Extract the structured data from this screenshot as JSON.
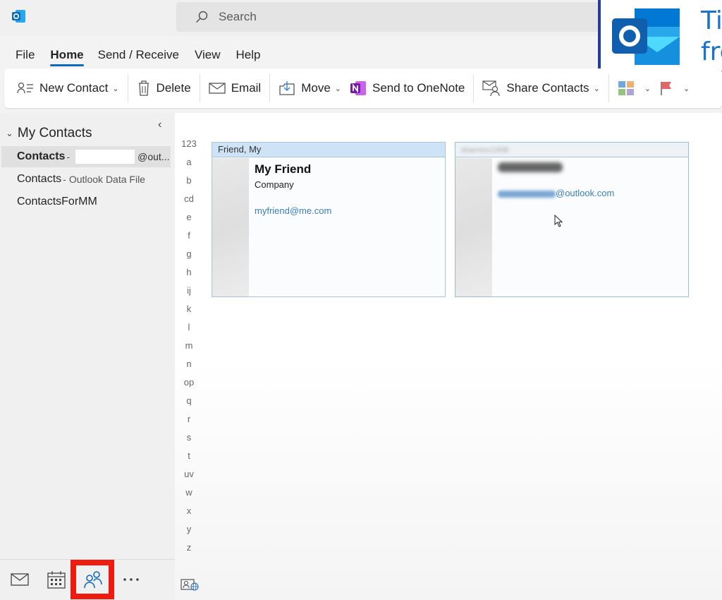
{
  "titlebar": {
    "app_icon": "outlook-logo-icon",
    "search_placeholder": "Search",
    "overlay_text_line1": "Ti",
    "overlay_text_line2": "fre"
  },
  "menu": {
    "tabs": [
      {
        "label": "File",
        "active": false
      },
      {
        "label": "Home",
        "active": true
      },
      {
        "label": "Send / Receive",
        "active": false
      },
      {
        "label": "View",
        "active": false
      },
      {
        "label": "Help",
        "active": false
      }
    ]
  },
  "ribbon": {
    "new_contact": "New Contact",
    "delete": "Delete",
    "email": "Email",
    "move": "Move",
    "send_to_onenote": "Send to OneNote",
    "share_contacts": "Share Contacts"
  },
  "folders": {
    "header": "My Contacts",
    "items": [
      {
        "label": "Contacts",
        "separator": " -",
        "suffix": "@out..."
      },
      {
        "label": "Contacts",
        "separator": " -",
        "sub": "Outlook Data File"
      },
      {
        "label": "ContactsForMM"
      }
    ]
  },
  "alphabet": [
    "123",
    "a",
    "b",
    "cd",
    "e",
    "f",
    "g",
    "h",
    "ij",
    "k",
    "l",
    "m",
    "n",
    "op",
    "q",
    "r",
    "s",
    "t",
    "uv",
    "w",
    "x",
    "y",
    "z"
  ],
  "cards": [
    {
      "file_as": "Friend, My",
      "name": "My Friend",
      "company": "Company",
      "email": "myfriend@me.com"
    },
    {
      "file_as": "sharronz1998",
      "email_domain": "@outlook.com"
    }
  ],
  "colors": {
    "accent": "#0f6cbd",
    "highlight": "#ee1c0e",
    "card_header": "#cfe3f6",
    "email_link": "#3a7fc1"
  }
}
